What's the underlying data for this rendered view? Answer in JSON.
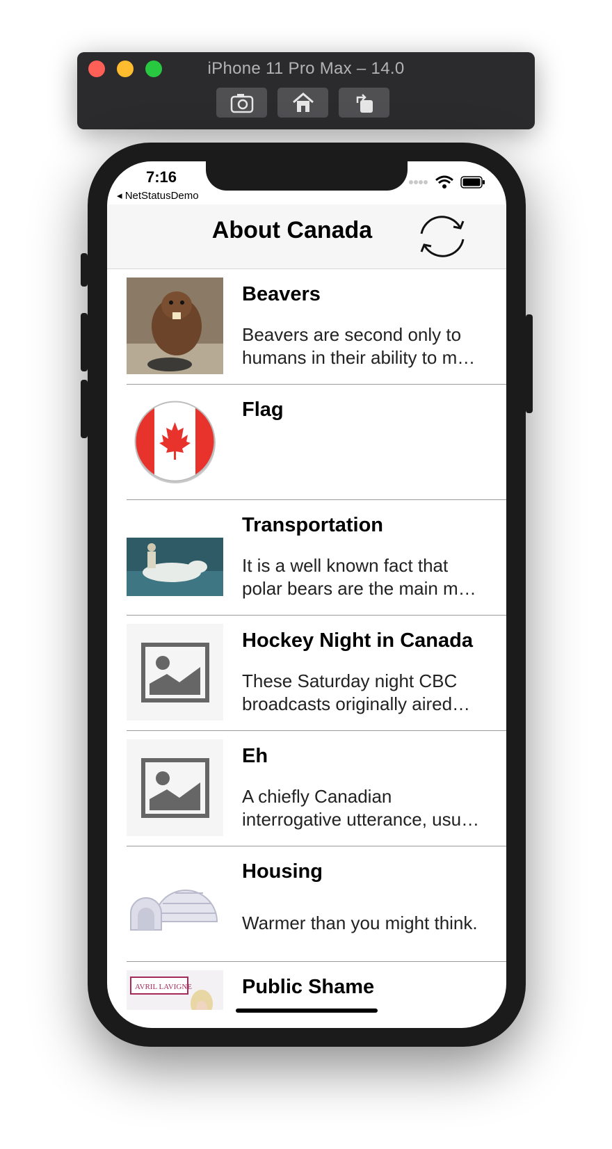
{
  "simulator": {
    "title": "iPhone 11 Pro Max – 14.0",
    "buttons": [
      {
        "icon": "camera-icon"
      },
      {
        "icon": "home-icon"
      },
      {
        "icon": "rotate-icon"
      }
    ]
  },
  "status_bar": {
    "time": "7:16",
    "back_app": "◂ NetStatusDemo"
  },
  "nav": {
    "title": "About Canada",
    "refresh_icon": "refresh-icon"
  },
  "rows": [
    {
      "title": "Beavers",
      "description": "Beavers are second only to humans in their ability to m…",
      "image": "beaver"
    },
    {
      "title": "Flag",
      "description": "",
      "image": "flag"
    },
    {
      "title": "Transportation",
      "description": "It is a well known fact that polar bears are the main m…",
      "image": "polar-bear"
    },
    {
      "title": "Hockey Night in Canada",
      "description": "These Saturday night CBC broadcasts originally aired…",
      "image": "placeholder"
    },
    {
      "title": "Eh",
      "description": "A chiefly Canadian interrogative utterance, usu…",
      "image": "placeholder"
    },
    {
      "title": "Housing",
      "description": "Warmer than you might think.",
      "image": "igloo"
    },
    {
      "title": "Public Shame",
      "description": "",
      "image": "avril-lavigne"
    }
  ],
  "thumbnail_texts": {
    "avril": "AVRIL LAVIGNE"
  }
}
